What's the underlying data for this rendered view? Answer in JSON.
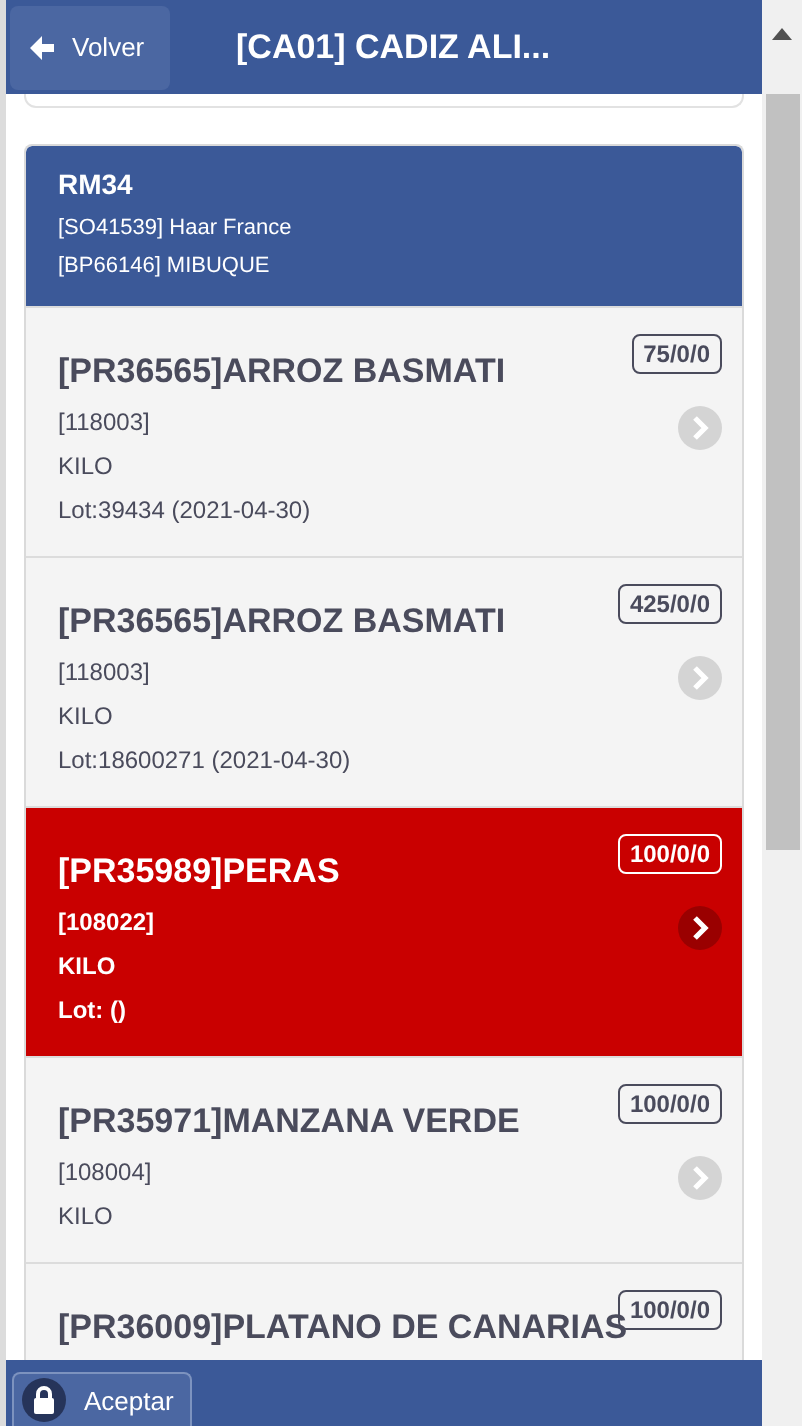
{
  "header": {
    "back_button": "Volver",
    "title": "[CA01] CADIZ ALI..."
  },
  "group": {
    "title": "RM34",
    "lines": [
      "[SO41539] Haar France",
      "[BP66146] MIBUQUE"
    ]
  },
  "items": [
    {
      "title": "[PR36565]ARROZ BASMATI",
      "code": "[118003]",
      "unit": "KILO",
      "lot": "Lot:39434 (2021-04-30)",
      "badge": "75/0/0",
      "selected": false
    },
    {
      "title": "[PR36565]ARROZ BASMATI",
      "code": "[118003]",
      "unit": "KILO",
      "lot": "Lot:18600271 (2021-04-30)",
      "badge": "425/0/0",
      "selected": false
    },
    {
      "title": "[PR35989]PERAS",
      "code": "[108022]",
      "unit": "KILO",
      "lot": "Lot: ()",
      "badge": "100/0/0",
      "selected": true
    },
    {
      "title": "[PR35971]MANZANA VERDE",
      "code": "[108004]",
      "unit": "KILO",
      "badge": "100/0/0",
      "selected": false
    },
    {
      "title": "[PR36009]PLATANO DE CANARIAS",
      "badge": "100/0/0",
      "selected": false
    }
  ],
  "footer": {
    "button": "Aceptar"
  }
}
